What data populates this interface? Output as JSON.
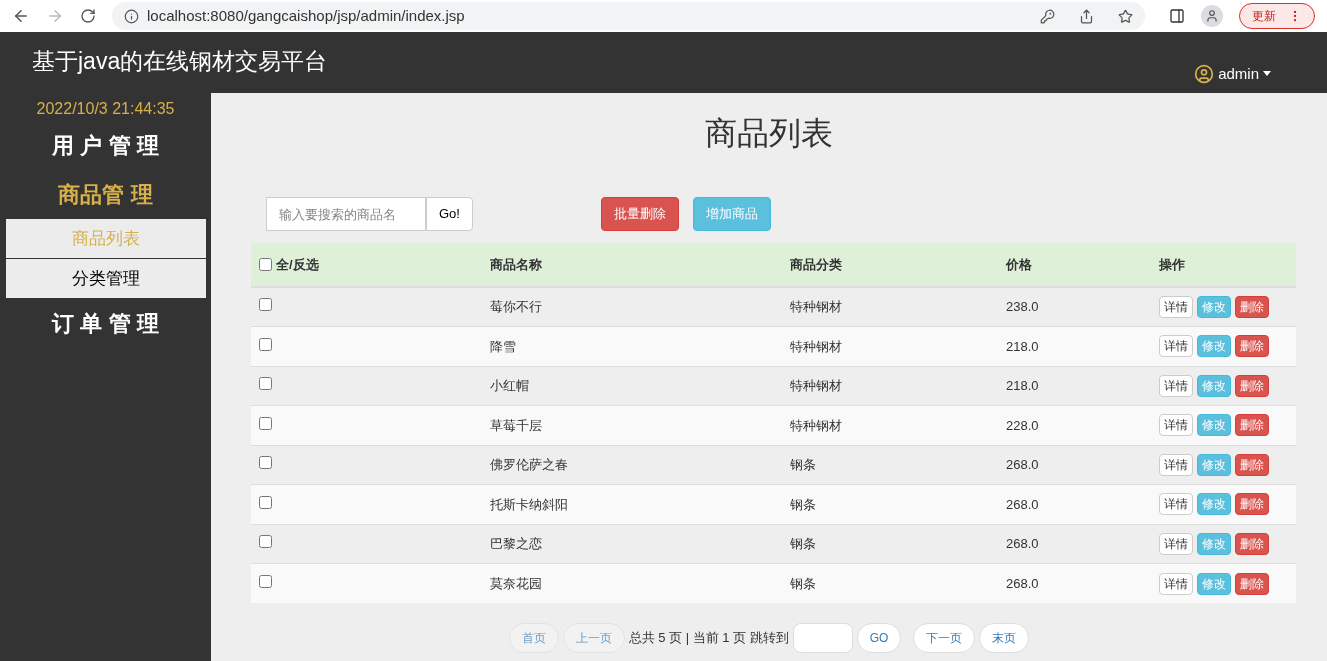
{
  "browser": {
    "url": "localhost:8080/gangcaishop/jsp/admin/index.jsp",
    "update_button": "更新"
  },
  "header": {
    "title": "基于java的在线钢材交易平台",
    "user": "admin"
  },
  "sidebar": {
    "datetime": "2022/10/3 21:44:35",
    "sections": [
      {
        "label": "用 户 管 理",
        "expanded": false
      },
      {
        "label": "商品管 理",
        "expanded": true,
        "children": [
          {
            "label": "商品列表",
            "selected": true
          },
          {
            "label": "分类管理",
            "selected": false
          }
        ]
      },
      {
        "label": "订 单 管 理",
        "expanded": false
      }
    ]
  },
  "page_title": "商品列表",
  "search": {
    "placeholder": "输入要搜索的商品名",
    "button": "Go!"
  },
  "actions": [
    {
      "label": "批量删除",
      "kind": "danger"
    },
    {
      "label": "增加商品",
      "kind": "info"
    }
  ],
  "table": {
    "select_all": {
      "label": "全/反选",
      "checked": false
    },
    "columns": [
      "商品名称",
      "商品分类",
      "价格",
      "操作"
    ],
    "rows": [
      {
        "checked": false,
        "name": "莓你不行",
        "category": "特种钢材",
        "price": "238.0",
        "buttons": [
          "详情",
          "修改",
          "删除"
        ]
      },
      {
        "checked": false,
        "name": "降雪",
        "category": "特种钢材",
        "price": "218.0",
        "buttons": [
          "详情",
          "修改",
          "删除"
        ]
      },
      {
        "checked": false,
        "name": "小红帽",
        "category": "特种钢材",
        "price": "218.0",
        "buttons": [
          "详情",
          "修改",
          "删除"
        ]
      },
      {
        "checked": false,
        "name": "草莓千层",
        "category": "特种钢材",
        "price": "228.0",
        "buttons": [
          "详情",
          "修改",
          "删除"
        ]
      },
      {
        "checked": false,
        "name": "佛罗伦萨之春",
        "category": "钢条",
        "price": "268.0",
        "buttons": [
          "详情",
          "修改",
          "删除"
        ]
      },
      {
        "checked": false,
        "name": "托斯卡纳斜阳",
        "category": "钢条",
        "price": "268.0",
        "buttons": [
          "详情",
          "修改",
          "删除"
        ]
      },
      {
        "checked": false,
        "name": "巴黎之恋",
        "category": "钢条",
        "price": "268.0",
        "buttons": [
          "详情",
          "修改",
          "删除"
        ]
      },
      {
        "checked": false,
        "name": "莫奈花园",
        "category": "钢条",
        "price": "268.0",
        "buttons": [
          "详情",
          "修改",
          "删除"
        ]
      }
    ]
  },
  "pagination": {
    "first": {
      "label": "首页",
      "disabled": true
    },
    "prev": {
      "label": "上一页",
      "disabled": true
    },
    "info": "总共 5 页 | 当前 1 页 跳转到",
    "go": "GO",
    "next": {
      "label": "下一页",
      "disabled": false
    },
    "last": {
      "label": "末页",
      "disabled": false
    }
  }
}
